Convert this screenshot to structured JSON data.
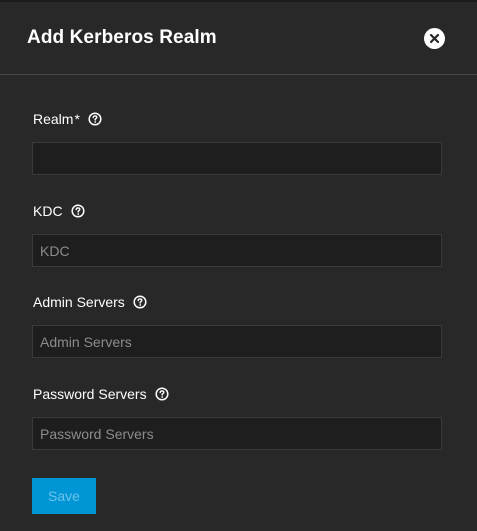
{
  "dialog": {
    "title": "Add Kerberos Realm",
    "close_icon": "close-circle-icon"
  },
  "fields": {
    "realm": {
      "label": "Realm",
      "required_marker": "*",
      "help_icon": "help-circle-icon",
      "value": "",
      "placeholder": ""
    },
    "kdc": {
      "label": "KDC",
      "help_icon": "help-circle-icon",
      "value": "",
      "placeholder": "KDC"
    },
    "admin_servers": {
      "label": "Admin Servers",
      "help_icon": "help-circle-icon",
      "value": "",
      "placeholder": "Admin Servers"
    },
    "password_servers": {
      "label": "Password Servers",
      "help_icon": "help-circle-icon",
      "value": "",
      "placeholder": "Password Servers"
    }
  },
  "actions": {
    "save_label": "Save",
    "save_disabled": true
  },
  "colors": {
    "background": "#282828",
    "input_background": "#1e1e1e",
    "accent": "#0095d5",
    "text": "#ffffff",
    "placeholder": "#8c8c8c"
  }
}
